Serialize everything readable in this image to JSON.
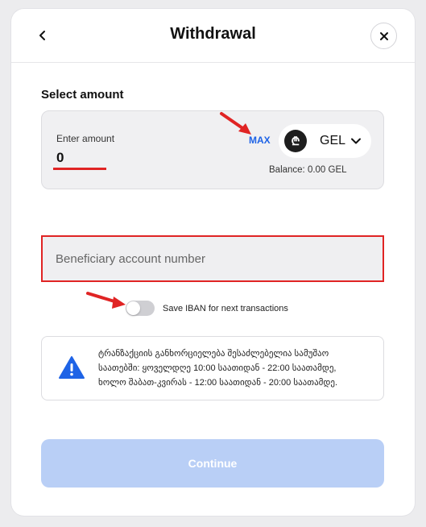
{
  "header": {
    "title": "Withdrawal",
    "back_icon": "chevron-left-icon",
    "close_icon": "close-icon"
  },
  "amount": {
    "section_title": "Select amount",
    "label": "Enter amount",
    "value": "0",
    "max_label": "MAX",
    "currency": "GEL",
    "currency_symbol": "₾",
    "balance": "Balance: 0.00 GEL"
  },
  "beneficiary": {
    "placeholder": "Beneficiary account number"
  },
  "save_iban": {
    "label": "Save IBAN for next transactions",
    "enabled": false
  },
  "info": {
    "icon": "warning-icon",
    "lines": [
      "ტრანზაქციის განხორციელება შესაძლებელია სამუშაო",
      "საათებში: ყოველდღე 10:00 საათიდან - 22:00 საათამდე,",
      "ხოლო შაბათ-კვირას - 12:00 საათიდან - 20:00 საათამდე."
    ]
  },
  "continue_label": "Continue",
  "colors": {
    "accent": "#1e63e6",
    "annotation": "#e02424",
    "disabled_button": "#b9cff6",
    "warning": "#1e63e6"
  }
}
